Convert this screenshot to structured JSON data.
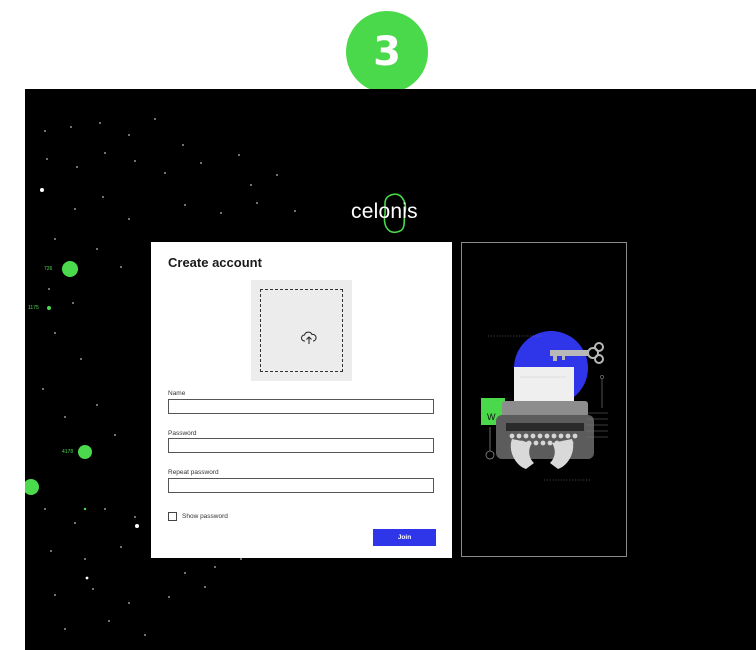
{
  "step": {
    "number": "3"
  },
  "brand": {
    "name": "celonis"
  },
  "background": {
    "node_labels": [
      "726",
      "1175",
      "4178"
    ]
  },
  "form": {
    "title": "Create account",
    "upload_icon": "upload-cloud-icon",
    "fields": [
      {
        "label": "Name",
        "value": ""
      },
      {
        "label": "Password",
        "value": ""
      },
      {
        "label": "Repeat password",
        "value": ""
      }
    ],
    "show_password": {
      "label": "Show password",
      "checked": false
    },
    "submit_label": "Join"
  },
  "illustration": {
    "keyboard_badge": "W"
  },
  "colors": {
    "accent_green": "#49d94a",
    "primary_blue": "#2f35e8",
    "background": "#000000"
  }
}
